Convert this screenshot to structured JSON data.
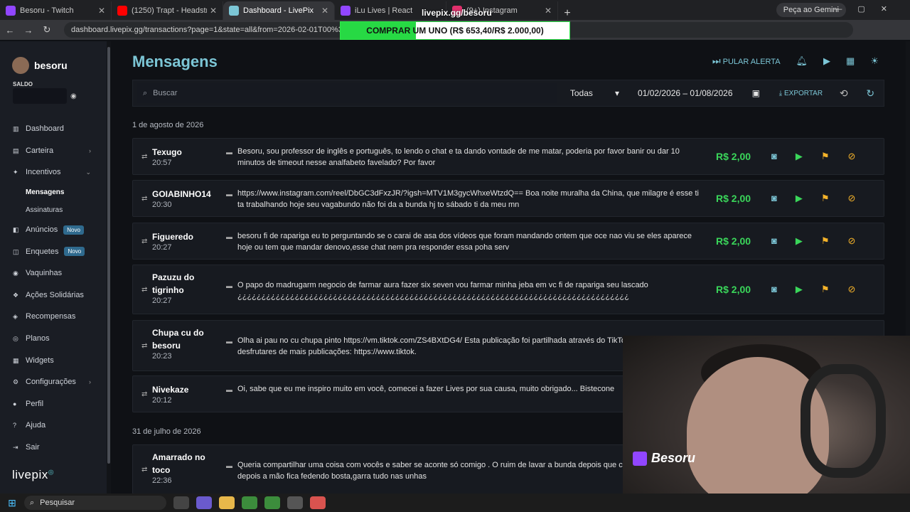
{
  "browser": {
    "tabs": [
      {
        "label": "Besoru - Twitch",
        "color": "#9146ff"
      },
      {
        "label": "(1250) Trapt - Headstrong (Live",
        "color": "#ff0000"
      },
      {
        "label": "Dashboard - LivePix",
        "color": "#7cc6d6"
      },
      {
        "label": "iLu Lives | React",
        "color": "#9146ff"
      },
      {
        "label": "(9+) Instagram",
        "color": "#e1306c"
      }
    ],
    "gemini_label": "Peça ao Gemini",
    "url": "dashboard.livepix.gg/transactions?page=1&state=all&from=2026-02-01T00%3A00%3A00"
  },
  "overlay": {
    "title": "livepix.gg/besoru",
    "progress_text": "COMPRAR UM UNO (R$ 653,40/R$ 2.000,00)",
    "progress_fraction": 0.33
  },
  "sidebar": {
    "username": "besoru",
    "saldo_label": "SALDO",
    "items": [
      {
        "label": "Dashboard",
        "icon": "▥"
      },
      {
        "label": "Carteira",
        "icon": "▤",
        "chev": "›"
      },
      {
        "label": "Incentivos",
        "icon": "✦",
        "chev": "⌄"
      },
      {
        "label": "Anúncios",
        "icon": "◧",
        "badge": "Novo"
      },
      {
        "label": "Enquetes",
        "icon": "◫",
        "badge": "Novo"
      },
      {
        "label": "Vaquinhas",
        "icon": "◉"
      },
      {
        "label": "Ações Solidárias",
        "icon": "❖"
      },
      {
        "label": "Recompensas",
        "icon": "◈"
      },
      {
        "label": "Planos",
        "icon": "◎"
      },
      {
        "label": "Widgets",
        "icon": "▦"
      },
      {
        "label": "Configurações",
        "icon": "⚙",
        "chev": "›"
      },
      {
        "label": "Perfil",
        "icon": "●"
      },
      {
        "label": "Ajuda",
        "icon": "?"
      },
      {
        "label": "Sair",
        "icon": "⇥"
      }
    ],
    "subitems": [
      "Mensagens",
      "Assinaturas"
    ],
    "logo": "livepix"
  },
  "main": {
    "title": "Mensagens",
    "skip_alert": "PULAR ALERTA",
    "search_placeholder": "Buscar",
    "filter_value": "Todas",
    "date_range": "01/02/2026 – 01/08/2026",
    "export_label": "EXPORTAR",
    "groups": [
      {
        "date": "1 de agosto de 2026",
        "rows": [
          {
            "name": "Texugo",
            "time": "20:57",
            "message": "Besoru, sou professor de inglês e português, to lendo o chat e ta dando vontade de me matar, poderia por favor banir ou dar 10 minutos de timeout nesse analfabeto favelado? Por favor",
            "amount": "R$ 2,00"
          },
          {
            "name": "GOIABINHO14",
            "time": "20:30",
            "message": "https://www.instagram.com/reel/DbGC3dFxzJR/?igsh=MTV1M3gycWhxeWtzdQ== Boa noite muralha da China, que milagre é esse ti ta trabalhando hoje seu vagabundo não foi da a bunda hj to sábado ti da meu mn",
            "amount": "R$ 2,00"
          },
          {
            "name": "Figueredo",
            "time": "20:27",
            "message": "besoru fi de rapariga eu to perguntando se o carai de asa dos vídeos que foram mandando ontem que oce nao viu se eles aparece hoje ou tem que mandar denovo,esse chat nem pra responder essa poha serv",
            "amount": "R$ 2,00"
          },
          {
            "name": "Pazuzu do tigrinho",
            "time": "20:27",
            "message": "O papo do madrugarm negocio de farmar aura fazer six seven vou farmar minha jeba em vc fi de rapariga seu lascado ¿¿¿¿¿¿¿¿¿¿¿¿¿¿¿¿¿¿¿¿¿¿¿¿¿¿¿¿¿¿¿¿¿¿¿¿¿¿¿¿¿¿¿¿¿¿¿¿¿¿¿¿¿¿¿¿¿¿¿¿¿¿¿¿¿¿¿¿¿¿¿¿¿¿¿¿¿¿¿¿¿¿",
            "amount": "R$ 2,00"
          },
          {
            "name": "Chupa cu do besoru",
            "time": "20:23",
            "message": "Olha ai pau no cu chupa pinto https://vm.tiktok.com/ZS4BXtDG4/ Esta publicação foi partilhada através do TikTok Lite para desfrutares de mais publicações: https://www.tiktok.",
            "amount": ""
          },
          {
            "name": "Nivekaze",
            "time": "20:12",
            "message": "Oi, sabe que eu me inspiro muito em você, comecei a fazer Lives por sua causa, muito obrigado... Bistecone",
            "amount": ""
          }
        ]
      },
      {
        "date": "31 de julho de 2026",
        "rows": [
          {
            "name": "Amarrado no toco",
            "time": "22:36",
            "message": "Queria compartilhar uma coisa com vocês e saber se aconte só comigo . O ruim de lavar a bunda depois que caga nos pelos do cu e depois a mão fica fedendo bosta,garra tudo nas unhas",
            "amount": ""
          }
        ]
      }
    ]
  },
  "webcam": {
    "watermark": "Besoru"
  },
  "taskbar": {
    "search_label": "Pesquisar"
  }
}
